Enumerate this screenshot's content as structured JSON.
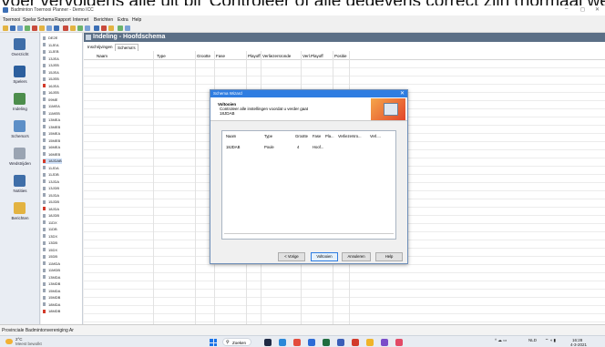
{
  "caption": "Voer vervolgens alle uit bij 'Controleer of alle gegevens correct zijn (normaal wel) en klik op Voltooien.",
  "window": {
    "title": "Badminton Toernooi Planner - Demo ICC",
    "controls": [
      "–",
      "◻",
      "✕"
    ]
  },
  "menu": [
    "Toernooi",
    "Spelar",
    "Schema",
    "Rapport",
    "Internet",
    "Berichten",
    "Extra",
    "Help"
  ],
  "nav": [
    {
      "label": "Overzicht",
      "icon": "overview-icon"
    },
    {
      "label": "Spelers",
      "icon": "players-icon"
    },
    {
      "label": "Indeling",
      "icon": "grouping-icon"
    },
    {
      "label": "Schema's",
      "icon": "schedules-icon"
    },
    {
      "label": "Wedstrijden",
      "icon": "matches-icon"
    },
    {
      "label": "Notities",
      "icon": "notes-icon"
    },
    {
      "label": "Berichten",
      "icon": "messages-icon"
    }
  ],
  "tree": [
    {
      "label": "DE2E",
      "red": false
    },
    {
      "label": "11JEA",
      "red": false
    },
    {
      "label": "11JEB",
      "red": false
    },
    {
      "label": "13JEA",
      "red": false
    },
    {
      "label": "13JEB",
      "red": false
    },
    {
      "label": "15JEA",
      "red": false
    },
    {
      "label": "15JEB",
      "red": false
    },
    {
      "label": "16JEA",
      "red": true
    },
    {
      "label": "16JEB",
      "red": false
    },
    {
      "label": "09ME",
      "red": false
    },
    {
      "label": "11MEA",
      "red": false
    },
    {
      "label": "11MEB",
      "red": false
    },
    {
      "label": "13MEA",
      "red": false
    },
    {
      "label": "13MEB",
      "red": false
    },
    {
      "label": "15MEA",
      "red": false
    },
    {
      "label": "15MEB",
      "red": false
    },
    {
      "label": "16MEA",
      "red": false
    },
    {
      "label": "16MEB",
      "red": false
    },
    {
      "label": "18JDAB",
      "red": true,
      "selected": true
    },
    {
      "label": "11JDA",
      "red": false
    },
    {
      "label": "11JDB",
      "red": false
    },
    {
      "label": "13JDA",
      "red": false
    },
    {
      "label": "13JDB",
      "red": false
    },
    {
      "label": "15JDA",
      "red": false
    },
    {
      "label": "15JDB",
      "red": false
    },
    {
      "label": "18JDA",
      "red": true
    },
    {
      "label": "18JDB",
      "red": false
    },
    {
      "label": "11DX",
      "red": false
    },
    {
      "label": "11DB",
      "red": false
    },
    {
      "label": "13DX",
      "red": false
    },
    {
      "label": "13DB",
      "red": false
    },
    {
      "label": "15DX",
      "red": false
    },
    {
      "label": "15DB",
      "red": false
    },
    {
      "label": "11MDA",
      "red": false
    },
    {
      "label": "11MDB",
      "red": false
    },
    {
      "label": "13MDA",
      "red": false
    },
    {
      "label": "13MDB",
      "red": false
    },
    {
      "label": "15MDA",
      "red": false
    },
    {
      "label": "15MDB",
      "red": false
    },
    {
      "label": "18MDA",
      "red": false
    },
    {
      "label": "18MDB",
      "red": true
    }
  ],
  "content": {
    "header": "Indeling - Hoofdschema",
    "tabs": [
      "Inschrijvingen",
      "Schema's"
    ],
    "columns": [
      "Naam",
      "Type",
      "Grootte",
      "Fase",
      "Playoff",
      "Verliezersronde",
      "Verl.Playoff",
      "Positie"
    ]
  },
  "dialog": {
    "title": "Schema Wizard",
    "close": "✕",
    "heading": "Voltooien",
    "line1": "Controleer alle instellingen voordat u verder gaat",
    "line2": "18JDAB",
    "columns": [
      "Naam",
      "Type",
      "Grootte",
      "Fase",
      "Pla...",
      "Verliezersro...",
      "Verl...."
    ],
    "row": [
      "18JDAB",
      "Poule",
      "4",
      "Hoof...",
      "",
      "",
      ""
    ],
    "buttons": {
      "back": "< Vorige",
      "finish": "Voltooien",
      "cancel": "Annuleren",
      "help": "Help"
    }
  },
  "status": "Provinciale Badmintonvereniging Ar",
  "taskbar": {
    "temp": "2°C",
    "weather": "Meest bewolkt",
    "search": "Zoeken",
    "lang": "NLD",
    "time": "16:28",
    "date": "4-3-2021"
  },
  "colors": {
    "accent": "#2f7de1",
    "header": "#5b6f86",
    "red": "#d23a2a"
  }
}
